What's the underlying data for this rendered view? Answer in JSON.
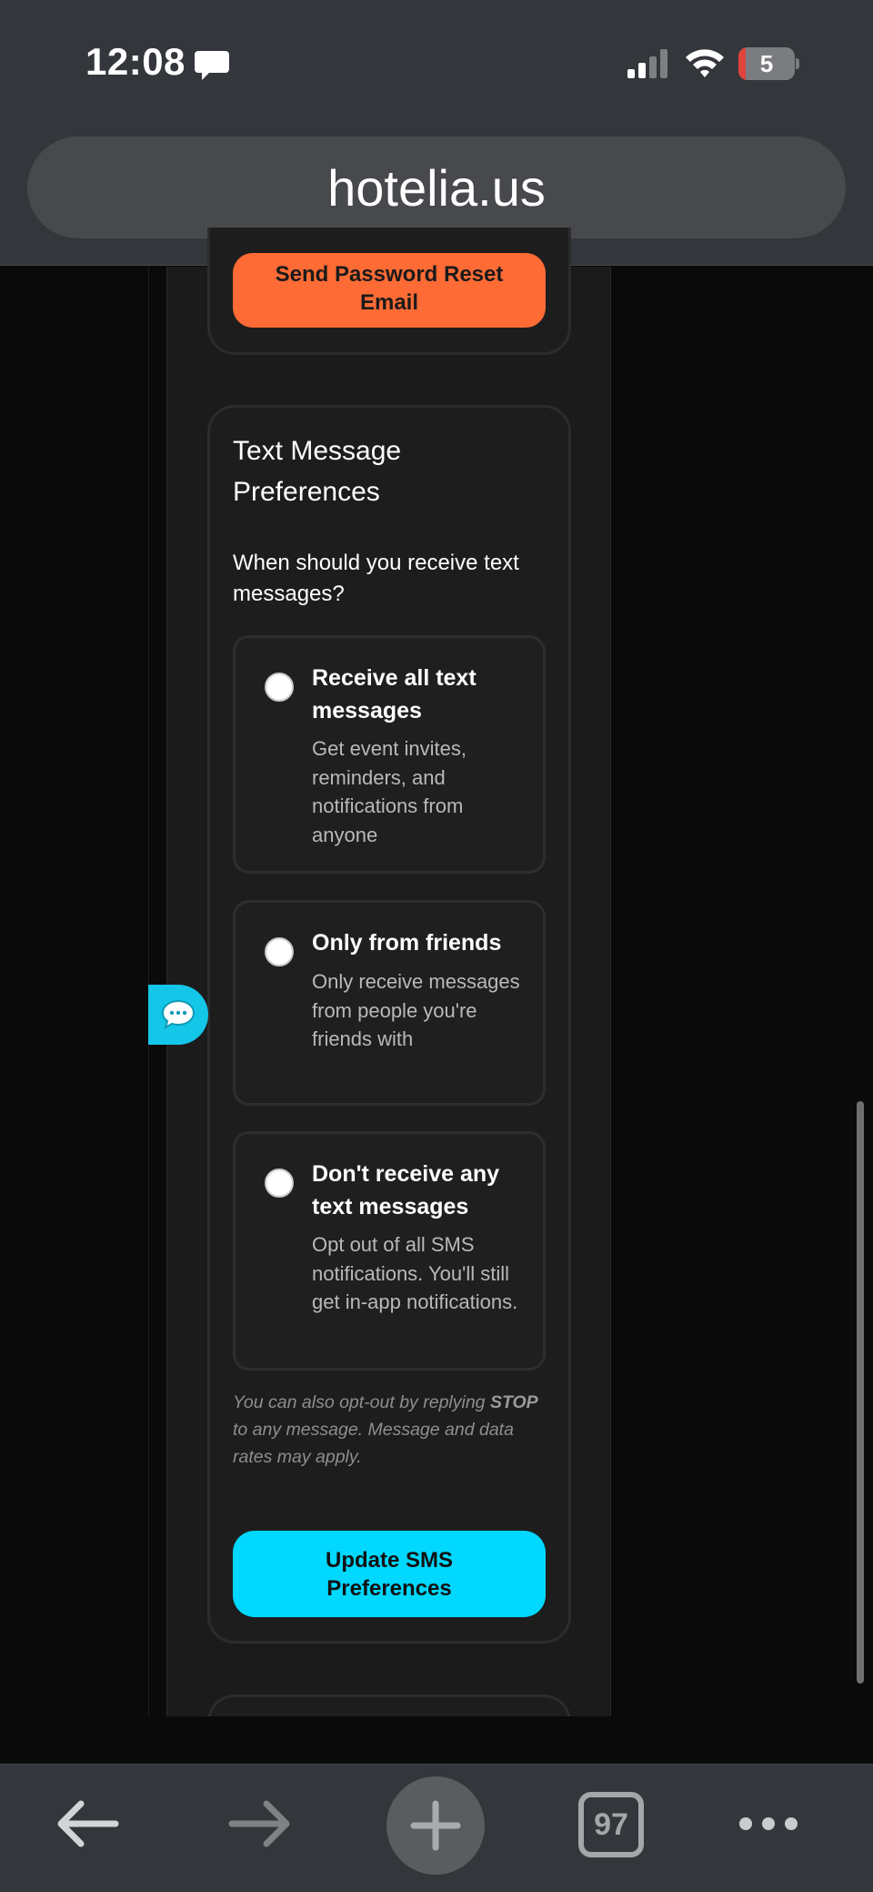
{
  "status_bar": {
    "time": "12:08",
    "battery_level": "5"
  },
  "browser": {
    "url": "hotelia.us",
    "tab_count": "97"
  },
  "password_section": {
    "reset_button_label": "Send Password Reset Email"
  },
  "sms_section": {
    "title": "Text Message Preferences",
    "question": "When should you receive text messages?",
    "options": [
      {
        "title": "Receive all text messages",
        "description": "Get event invites, reminders, and notifications from anyone",
        "selected": false
      },
      {
        "title": "Only from friends",
        "description": "Only receive messages from people you're friends with",
        "selected": false
      },
      {
        "title": "Don't receive any text messages",
        "description": "Opt out of all SMS notifications. You'll still get in-app notifications.",
        "selected": false
      }
    ],
    "note_prefix": "You can also opt-out by replying ",
    "note_keyword": "STOP",
    "note_suffix": " to any message. Message and data rates may apply.",
    "update_button_label": "Update SMS Preferences"
  },
  "icons": {
    "status": [
      "message-icon",
      "cellular-signal-icon",
      "wifi-icon",
      "battery-icon"
    ],
    "toolbar": [
      "back-arrow-icon",
      "forward-arrow-icon",
      "plus-icon",
      "tabs-icon",
      "more-icon"
    ],
    "floating": "chat-icon"
  },
  "colors": {
    "reset_button": "#ff6b35",
    "update_button": "#00d8ff",
    "chat_bubble": "#14c6e8",
    "card_background": "#1d1d1d",
    "browser_chrome": "#33363b",
    "battery_low": "#e0443c"
  }
}
